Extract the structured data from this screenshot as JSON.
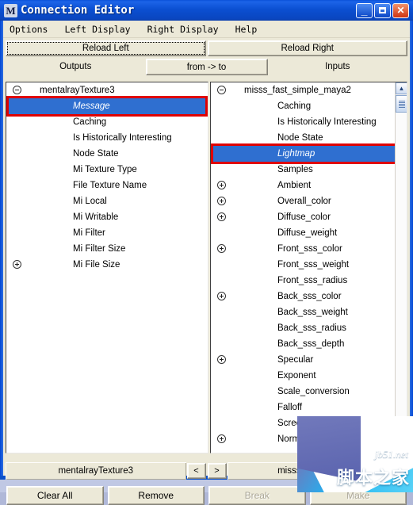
{
  "window": {
    "title": "Connection Editor",
    "icon": "maya-app-icon",
    "buttons": {
      "minimize": "minimize-icon",
      "maximize": "maximize-icon",
      "close": "close-icon"
    }
  },
  "menubar": {
    "items": [
      {
        "label": "Options"
      },
      {
        "label": "Left Display"
      },
      {
        "label": "Right Display"
      },
      {
        "label": "Help"
      }
    ]
  },
  "toolbar": {
    "reload_left": "Reload Left",
    "reload_right": "Reload Right"
  },
  "tabs": {
    "outputs": "Outputs",
    "from_to": "from -> to",
    "inputs": "Inputs"
  },
  "left_pane": {
    "root": {
      "label": "mentalrayTexture3",
      "expander": "minus"
    },
    "items": [
      {
        "label": "Message",
        "expander": "none",
        "selected": true
      },
      {
        "label": "Caching",
        "expander": "none",
        "selected": false
      },
      {
        "label": "Is Historically Interesting",
        "expander": "none",
        "selected": false
      },
      {
        "label": "Node State",
        "expander": "none",
        "selected": false
      },
      {
        "label": "Mi Texture Type",
        "expander": "none",
        "selected": false
      },
      {
        "label": "File Texture Name",
        "expander": "none",
        "selected": false
      },
      {
        "label": "Mi Local",
        "expander": "none",
        "selected": false
      },
      {
        "label": "Mi Writable",
        "expander": "none",
        "selected": false
      },
      {
        "label": "Mi Filter",
        "expander": "none",
        "selected": false
      },
      {
        "label": "Mi Filter Size",
        "expander": "none",
        "selected": false
      },
      {
        "label": "Mi File Size",
        "expander": "plus",
        "selected": false
      }
    ]
  },
  "right_pane": {
    "root": {
      "label": "misss_fast_simple_maya2",
      "expander": "minus"
    },
    "items": [
      {
        "label": "Caching",
        "expander": "none",
        "selected": false
      },
      {
        "label": "Is Historically Interesting",
        "expander": "none",
        "selected": false
      },
      {
        "label": "Node State",
        "expander": "none",
        "selected": false
      },
      {
        "label": "Lightmap",
        "expander": "none",
        "selected": true
      },
      {
        "label": "Samples",
        "expander": "none",
        "selected": false
      },
      {
        "label": "Ambient",
        "expander": "plus",
        "selected": false
      },
      {
        "label": "Overall_color",
        "expander": "plus",
        "selected": false
      },
      {
        "label": "Diffuse_color",
        "expander": "plus",
        "selected": false
      },
      {
        "label": "Diffuse_weight",
        "expander": "none",
        "selected": false
      },
      {
        "label": "Front_sss_color",
        "expander": "plus",
        "selected": false
      },
      {
        "label": "Front_sss_weight",
        "expander": "none",
        "selected": false
      },
      {
        "label": "Front_sss_radius",
        "expander": "none",
        "selected": false
      },
      {
        "label": "Back_sss_color",
        "expander": "plus",
        "selected": false
      },
      {
        "label": "Back_sss_weight",
        "expander": "none",
        "selected": false
      },
      {
        "label": "Back_sss_radius",
        "expander": "none",
        "selected": false
      },
      {
        "label": "Back_sss_depth",
        "expander": "none",
        "selected": false
      },
      {
        "label": "Specular",
        "expander": "plus",
        "selected": false
      },
      {
        "label": "Exponent",
        "expander": "none",
        "selected": false
      },
      {
        "label": "Scale_conversion",
        "expander": "none",
        "selected": false
      },
      {
        "label": "Falloff",
        "expander": "none",
        "selected": false
      },
      {
        "label": "Screen_comp",
        "expander": "none",
        "selected": false
      },
      {
        "label": "Normal Came",
        "expander": "plus",
        "selected": false
      }
    ],
    "scrollbar": {
      "up_arrow": "scroll-up-icon",
      "thumb": "scroll-thumb"
    }
  },
  "name_row": {
    "left_name": "mentalrayTexture3",
    "prev_label": "<",
    "next_label": ">",
    "right_name": "misss_fast_simple_"
  },
  "bottom_buttons": [
    {
      "label": "Clear All",
      "disabled": false
    },
    {
      "label": "Remove",
      "disabled": false
    },
    {
      "label": "Break",
      "disabled": true
    },
    {
      "label": "Make",
      "disabled": true
    }
  ],
  "watermark": {
    "english": "jb51.net",
    "chinese": "脚本之家"
  },
  "colors": {
    "selection": "#2f6fd0",
    "annotation": "#e00000",
    "window_face": "#ece9d8",
    "titlebar": "#0b4fd2"
  }
}
